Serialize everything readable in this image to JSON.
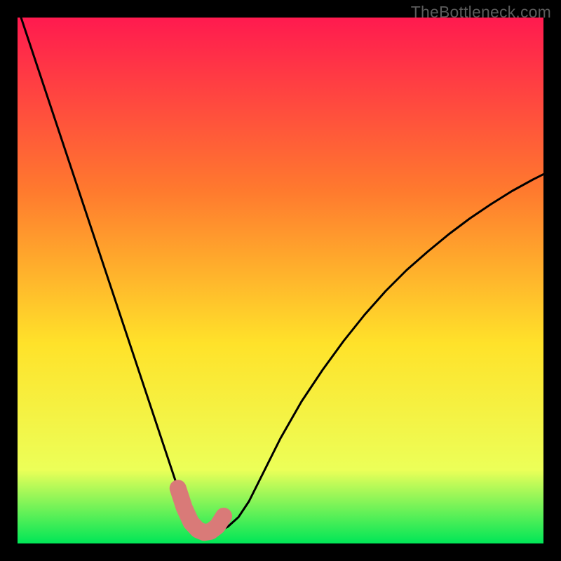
{
  "watermark": "TheBottleneck.com",
  "colors": {
    "frame": "#000000",
    "gradient_top": "#ff1a4f",
    "gradient_mid_upper": "#ff7a2e",
    "gradient_mid": "#ffe22a",
    "gradient_lower": "#ecff58",
    "gradient_bottom": "#00e657",
    "curve": "#000000",
    "marker_fill": "#d97a78",
    "marker_stroke": "#c25a57"
  },
  "chart_data": {
    "type": "line",
    "title": "",
    "xlabel": "",
    "ylabel": "",
    "xlim": [
      0,
      100
    ],
    "ylim": [
      0,
      100
    ],
    "x": [
      0,
      2,
      4,
      6,
      8,
      10,
      12,
      14,
      16,
      18,
      20,
      22,
      24,
      26,
      28,
      30,
      31,
      32,
      33,
      34,
      35,
      36,
      38,
      40,
      42,
      44,
      46,
      48,
      50,
      54,
      58,
      62,
      66,
      70,
      74,
      78,
      82,
      86,
      90,
      94,
      98,
      100
    ],
    "series": [
      {
        "name": "bottleneck-curve",
        "values": [
          102,
          96,
          90,
          84,
          78,
          72,
          66,
          60,
          54,
          48,
          42,
          36,
          30,
          24,
          18,
          12,
          9,
          6.5,
          4.5,
          3,
          2.2,
          2,
          2.2,
          3.2,
          5,
          8,
          12,
          16,
          20,
          27,
          33,
          38.5,
          43.5,
          48,
          52,
          55.5,
          58.8,
          61.8,
          64.5,
          67,
          69.2,
          70.2
        ]
      }
    ],
    "markers": {
      "name": "highlight-segment",
      "x": [
        30.5,
        31.7,
        33.0,
        34.3,
        35.5,
        36.7,
        38.0,
        39.2
      ],
      "y": [
        10.5,
        6.8,
        4.0,
        2.6,
        2.1,
        2.3,
        3.3,
        5.2
      ]
    }
  }
}
